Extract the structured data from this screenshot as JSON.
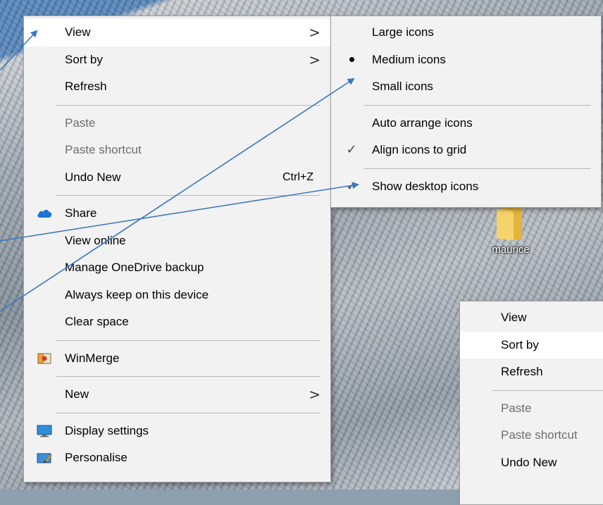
{
  "main_menu": {
    "items": [
      {
        "label": "View",
        "arrow": ">"
      },
      {
        "label": "Sort by",
        "arrow": ">"
      },
      {
        "label": "Refresh"
      },
      {
        "label": "Paste"
      },
      {
        "label": "Paste shortcut"
      },
      {
        "label": "Undo New",
        "shortcut": "Ctrl+Z"
      },
      {
        "label": "Share"
      },
      {
        "label": "View online"
      },
      {
        "label": "Manage OneDrive backup"
      },
      {
        "label": "Always keep on this device"
      },
      {
        "label": "Clear space"
      },
      {
        "label": "WinMerge"
      },
      {
        "label": "New",
        "arrow": ">"
      },
      {
        "label": "Display settings"
      },
      {
        "label": "Personalise"
      }
    ]
  },
  "view_submenu": {
    "items": [
      {
        "label": "Large icons"
      },
      {
        "label": "Medium icons",
        "marker": "•"
      },
      {
        "label": "Small icons"
      },
      {
        "label": "Auto arrange icons"
      },
      {
        "label": "Align icons to grid",
        "marker": "✓"
      },
      {
        "label": "Show desktop icons",
        "marker": "✓"
      }
    ]
  },
  "desktop_icon": {
    "label": "maurice"
  },
  "secondary_menu": {
    "items": [
      {
        "label": "View"
      },
      {
        "label": "Sort by"
      },
      {
        "label": "Refresh"
      },
      {
        "label": "Paste"
      },
      {
        "label": "Paste shortcut"
      },
      {
        "label": "Undo New"
      }
    ]
  },
  "colors": {
    "menu_bg": "#f2f2f2",
    "menu_hover": "#ffffff",
    "annotation_arrow": "#3a78c2",
    "onedrive_blue": "#1e73d2"
  }
}
